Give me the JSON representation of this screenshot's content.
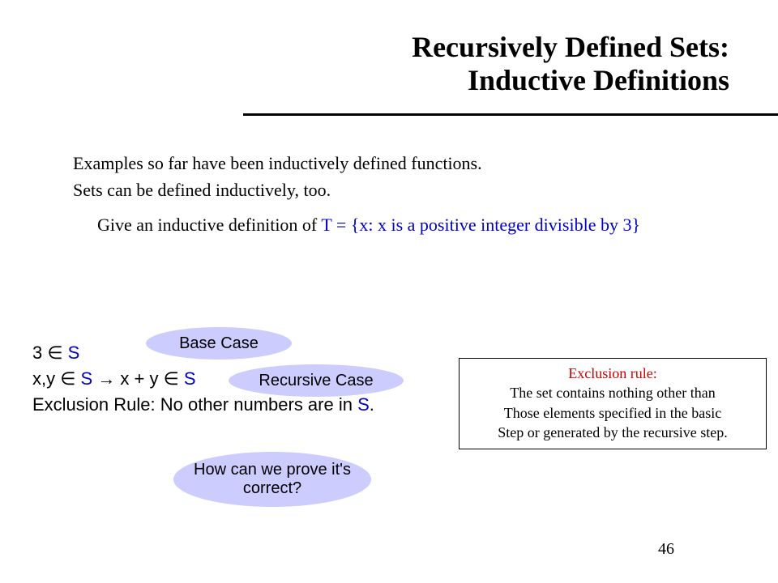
{
  "title": {
    "line1": "Recursively Defined Sets:",
    "line2": "Inductive Definitions"
  },
  "intro": {
    "line1": "Examples so far have been inductively defined functions.",
    "line2": "Sets can be defined inductively, too."
  },
  "prompt": {
    "lead": "Give an inductive definition of ",
    "setdef": "T = {x: x is a positive integer divisible by  3}"
  },
  "rules": {
    "base_pre": "3 ∈ ",
    "base_S": "S",
    "rec_pre": "x,y ∈ ",
    "rec_S1": "S",
    "rec_mid": " → x + y ∈ ",
    "rec_S2": "S",
    "excl_pre": "Exclusion Rule: No other numbers are in ",
    "excl_S": "S",
    "excl_post": "."
  },
  "bubbles": {
    "base": "Base Case",
    "recursive": "Recursive Case",
    "prove": "How can we  prove it's correct?"
  },
  "exclusion_box": {
    "title": "Exclusion rule:",
    "l1": "The set contains nothing other than",
    "l2": "Those elements specified in the basic",
    "l3": "Step or generated by the recursive step."
  },
  "pagenum": "46"
}
